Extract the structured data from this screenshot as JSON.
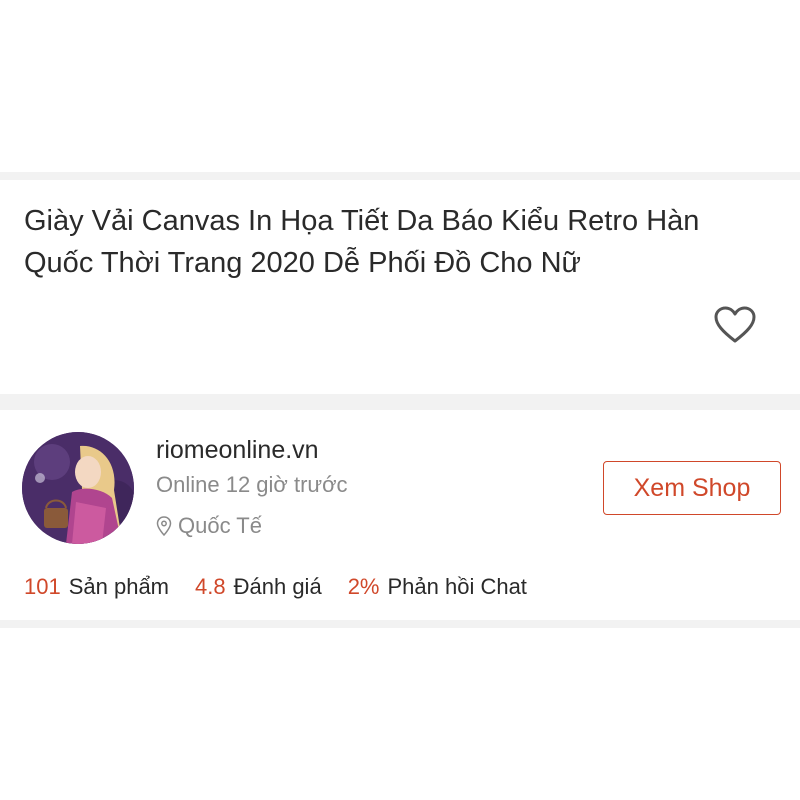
{
  "product": {
    "title": "Giày Vải Canvas In Họa Tiết Da Báo Kiểu Retro Hàn Quốc Thời Trang 2020 Dễ Phối Đồ Cho Nữ",
    "favorite_icon": "heart-outline-icon"
  },
  "shop": {
    "name": "riomeonline.vn",
    "status": "Online 12 giờ trước",
    "location": "Quốc Tế",
    "location_icon": "location-pin-icon",
    "view_button": "Xem Shop",
    "stats": {
      "products_count": "101",
      "products_label": "Sản phẩm",
      "rating_value": "4.8",
      "rating_label": "Đánh giá",
      "chat_response_value": "2%",
      "chat_response_label": "Phản hồi Chat"
    }
  },
  "colors": {
    "accent": "#d0482a",
    "muted_text": "#8a8a8a",
    "divider": "#f2f2f2"
  }
}
